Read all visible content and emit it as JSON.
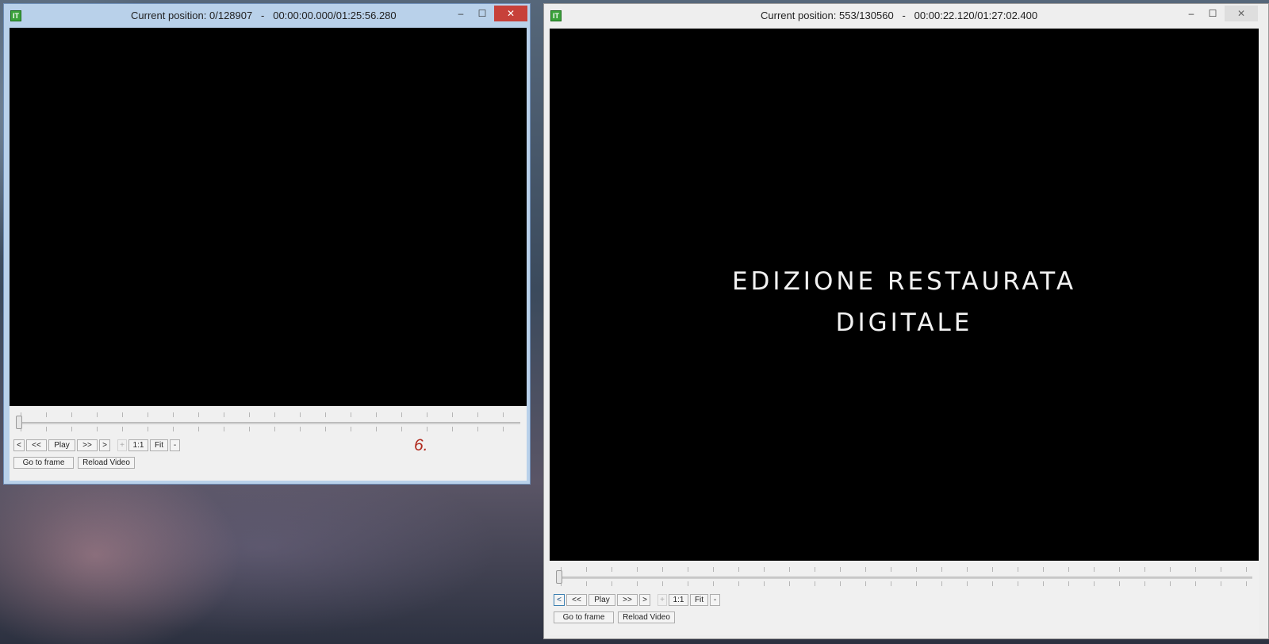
{
  "window_left": {
    "title": "Current position: 0/128907   -   00:00:00.000/01:25:56.280",
    "buttons": {
      "prev_frame": "<",
      "rewind": "<<",
      "play": "Play",
      "forward": ">>",
      "next_frame": ">",
      "zoom_in": "+",
      "zoom_1to1": "1:1",
      "fit": "Fit",
      "zoom_out": "-"
    },
    "go_to_frame": "Go to frame",
    "reload_video": "Reload Video",
    "annotation": "6.",
    "controls": {
      "minimize": "–",
      "maximize": "☐",
      "close": "✕"
    }
  },
  "window_right": {
    "title": "Current position: 553/130560   -   00:00:22.120/01:27:02.400",
    "video_text": [
      "EDIZIONE RESTAURATA",
      "DIGITALE"
    ],
    "buttons": {
      "prev_frame": "<",
      "rewind": "<<",
      "play": "Play",
      "forward": ">>",
      "next_frame": ">",
      "zoom_in": "+",
      "zoom_1to1": "1:1",
      "fit": "Fit",
      "zoom_out": "-"
    },
    "go_to_frame": "Go to frame",
    "reload_video": "Reload Video",
    "controls": {
      "minimize": "–",
      "maximize": "☐",
      "close": "✕"
    }
  },
  "icons": {
    "app": "app-icon",
    "minimize": "minimize-icon",
    "maximize": "maximize-icon",
    "close": "close-icon"
  },
  "colors": {
    "active_close": "#c7413a",
    "annotation": "#b02a1e",
    "video_bg": "#000000"
  }
}
